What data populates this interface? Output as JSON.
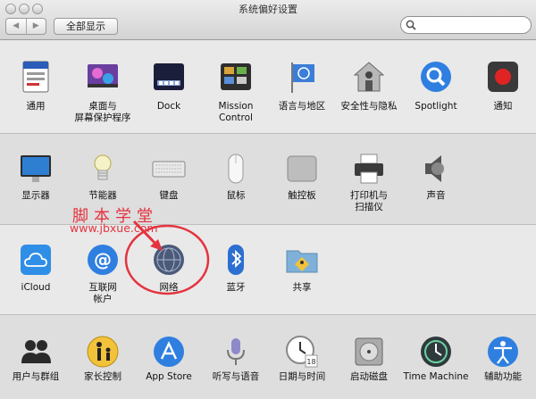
{
  "window": {
    "title": "系统偏好设置"
  },
  "toolbar": {
    "back": "◀",
    "forward": "▶",
    "show_all": "全部显示",
    "search_placeholder": ""
  },
  "rows": [
    [
      {
        "name": "general",
        "icon": "general-icon",
        "label": "通用"
      },
      {
        "name": "desktop-screensaver",
        "icon": "desktop-icon",
        "label": "桌面与\n屏幕保护程序"
      },
      {
        "name": "dock",
        "icon": "dock-icon",
        "label": "Dock"
      },
      {
        "name": "mission-control",
        "icon": "mission-control-icon",
        "label": "Mission\nControl"
      },
      {
        "name": "language-region",
        "icon": "flag-icon",
        "label": "语言与地区"
      },
      {
        "name": "security-privacy",
        "icon": "house-icon",
        "label": "安全性与隐私"
      },
      {
        "name": "spotlight",
        "icon": "spotlight-icon",
        "label": "Spotlight"
      },
      {
        "name": "notifications",
        "icon": "notifications-icon",
        "label": "通知"
      }
    ],
    [
      {
        "name": "displays",
        "icon": "display-icon",
        "label": "显示器"
      },
      {
        "name": "energy-saver",
        "icon": "bulb-icon",
        "label": "节能器"
      },
      {
        "name": "keyboard",
        "icon": "keyboard-icon",
        "label": "键盘"
      },
      {
        "name": "mouse",
        "icon": "mouse-icon",
        "label": "鼠标"
      },
      {
        "name": "trackpad",
        "icon": "trackpad-icon",
        "label": "触控板"
      },
      {
        "name": "printers-scanners",
        "icon": "printer-icon",
        "label": "打印机与\n扫描仪"
      },
      {
        "name": "sound",
        "icon": "speaker-icon",
        "label": "声音"
      }
    ],
    [
      {
        "name": "icloud",
        "icon": "icloud-icon",
        "label": "iCloud"
      },
      {
        "name": "internet-accounts",
        "icon": "at-icon",
        "label": "互联网\n帐户"
      },
      {
        "name": "network",
        "icon": "network-globe-icon",
        "label": "网络"
      },
      {
        "name": "bluetooth",
        "icon": "bluetooth-icon",
        "label": "蓝牙"
      },
      {
        "name": "sharing",
        "icon": "sharing-folder-icon",
        "label": "共享"
      }
    ],
    [
      {
        "name": "users-groups",
        "icon": "users-icon",
        "label": "用户与群组"
      },
      {
        "name": "parental-controls",
        "icon": "parental-icon",
        "label": "家长控制"
      },
      {
        "name": "app-store",
        "icon": "appstore-icon",
        "label": "App Store"
      },
      {
        "name": "dictation-speech",
        "icon": "microphone-icon",
        "label": "听写与语音"
      },
      {
        "name": "date-time",
        "icon": "clock-icon",
        "label": "日期与时间"
      },
      {
        "name": "startup-disk",
        "icon": "disk-icon",
        "label": "启动磁盘"
      },
      {
        "name": "time-machine",
        "icon": "time-machine-icon",
        "label": "Time Machine"
      },
      {
        "name": "accessibility",
        "icon": "accessibility-icon",
        "label": "辅助功能"
      }
    ]
  ],
  "watermark": {
    "line1": "脚本学堂",
    "line2": "www.jbxue.com"
  },
  "colors": {
    "annotation": "#e4333f"
  }
}
